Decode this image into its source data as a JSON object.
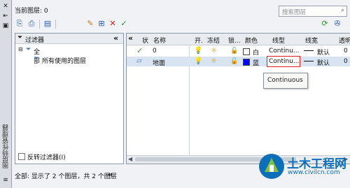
{
  "title_bar": {
    "vertical_title": "图层特性管理器",
    "pin_icon": "pin-icon",
    "close_icon": "close-icon"
  },
  "header": {
    "current_layer": "当前图层: 0",
    "search_placeholder": "搜索图层"
  },
  "tree": {
    "header": "过滤器",
    "collapse": "«",
    "items": [
      {
        "label": "全部"
      },
      {
        "label": "所有使用的图层"
      }
    ],
    "invert_filter": "反转过滤器(I)"
  },
  "grid": {
    "collapse": "«",
    "columns": [
      "状",
      "名称",
      "开.",
      "冻结",
      "锁...",
      "颜色",
      "线型",
      "线宽",
      "透明度"
    ],
    "rows": [
      {
        "status": "✓",
        "name": "0",
        "color_name": "白",
        "color": "#ffffff",
        "linetype": "Continu...",
        "lineweight": "默认",
        "transparency": "0"
      },
      {
        "status": "",
        "name": "地面",
        "color_name": "蓝",
        "color": "#0000ff",
        "linetype": "Continu...",
        "lineweight": "默认",
        "transparency": "0"
      }
    ]
  },
  "tooltip": {
    "text": "Continuous"
  },
  "status_bar": {
    "text": "全部: 显示了 2 个图层，共 2 个图层"
  },
  "watermark": {
    "name": "土木工程网",
    "url": "www.civilcn.com"
  },
  "colors": {
    "accent": "#1e5eb0",
    "highlight": "#e02020",
    "watermark": "#0d6fb8"
  }
}
